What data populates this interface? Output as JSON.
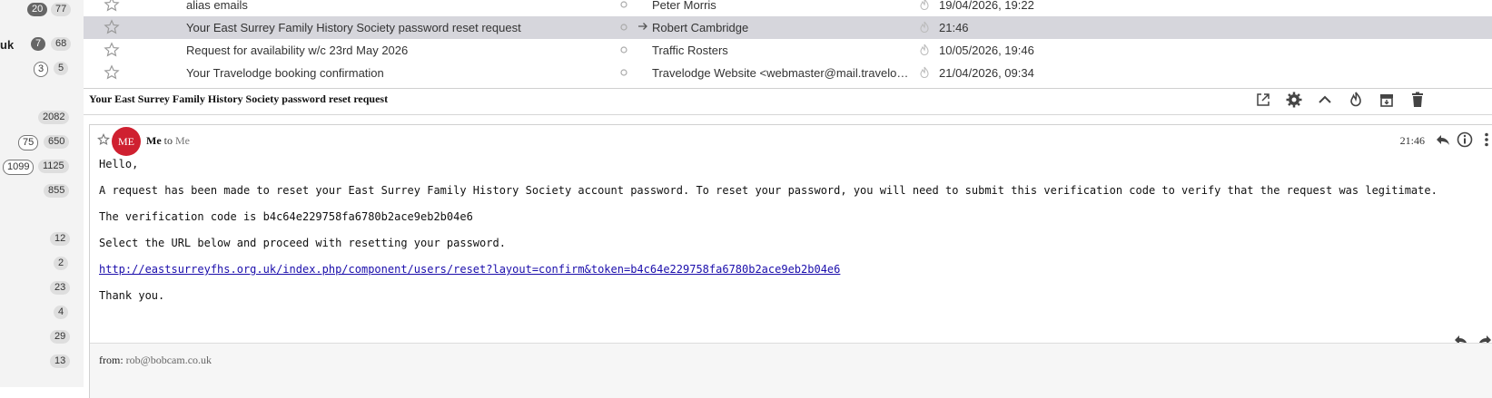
{
  "sidebar": {
    "rows": [
      {
        "name": "",
        "unread": "20",
        "total": "77",
        "unread_style": "filled"
      },
      {
        "name": "uk",
        "unread": "7",
        "total": "68",
        "unread_style": "filled"
      },
      {
        "name": "",
        "unread": "3",
        "total": "5",
        "unread_style": "outline"
      },
      {
        "name": "",
        "unread": "",
        "total": "2082",
        "unread_style": ""
      },
      {
        "name": "",
        "unread": "75",
        "total": "650",
        "unread_style": "outline"
      },
      {
        "name": "",
        "unread": "1099",
        "total": "1125",
        "unread_style": "outline"
      },
      {
        "name": "",
        "unread": "",
        "total": "855",
        "unread_style": ""
      },
      {
        "name": "",
        "unread": "",
        "total": "12",
        "unread_style": ""
      },
      {
        "name": "",
        "unread": "",
        "total": "2",
        "unread_style": ""
      },
      {
        "name": "",
        "unread": "",
        "total": "23",
        "unread_style": ""
      },
      {
        "name": "",
        "unread": "",
        "total": "4",
        "unread_style": ""
      },
      {
        "name": "",
        "unread": "",
        "total": "29",
        "unread_style": ""
      },
      {
        "name": "",
        "unread": "",
        "total": "13",
        "unread_style": ""
      }
    ]
  },
  "message_list": [
    {
      "subject": "alias emails",
      "from": "Peter Morris",
      "date": "19/04/2026, 19:22",
      "selected": false,
      "replied": false
    },
    {
      "subject": "Your East Surrey Family History Society password reset request",
      "from": "Robert Cambridge",
      "date": "21:46",
      "selected": true,
      "replied": true
    },
    {
      "subject": "Request for availability w/c 23rd May 2026",
      "from": "Traffic Rosters",
      "date": "10/05/2026, 19:46",
      "selected": false,
      "replied": false
    },
    {
      "subject": "Your Travelodge booking confirmation",
      "from": "Travelodge Website <webmaster@mail.travelodge.co.uk>",
      "date": "21/04/2026, 09:34",
      "selected": false,
      "replied": false
    }
  ],
  "viewer": {
    "title": "Your East Surrey Family History Society password reset request",
    "toolbar_icons": [
      "open-in-new-window-icon",
      "settings-icon",
      "collapse-icon",
      "junk-icon",
      "archive-icon",
      "delete-icon"
    ]
  },
  "message": {
    "avatar_initials": "ME",
    "sender": "Me",
    "to_word": "to",
    "recipient": "Me",
    "time": "21:46",
    "greeting": "Hello,",
    "paragraph1": "A request has been made to reset your East Surrey Family History Society account password. To reset your password, you will need to submit this verification code to verify that the request was legitimate.",
    "paragraph2": "The verification code is b4c64e229758fa6780b2ace9eb2b04e6",
    "paragraph3": "Select the URL below and proceed with resetting your password.",
    "link": "http://eastsurreyfhs.org.uk/index.php/component/users/reset?layout=confirm&token=b4c64e229758fa6780b2ace9eb2b04e6",
    "closing": "Thank you.",
    "from_label": "from:",
    "from_value": "rob@bobcam.co.uk"
  },
  "colors": {
    "avatar": "#cf2030",
    "selected_row": "#d6d6dc",
    "link": "#1a0dab"
  }
}
